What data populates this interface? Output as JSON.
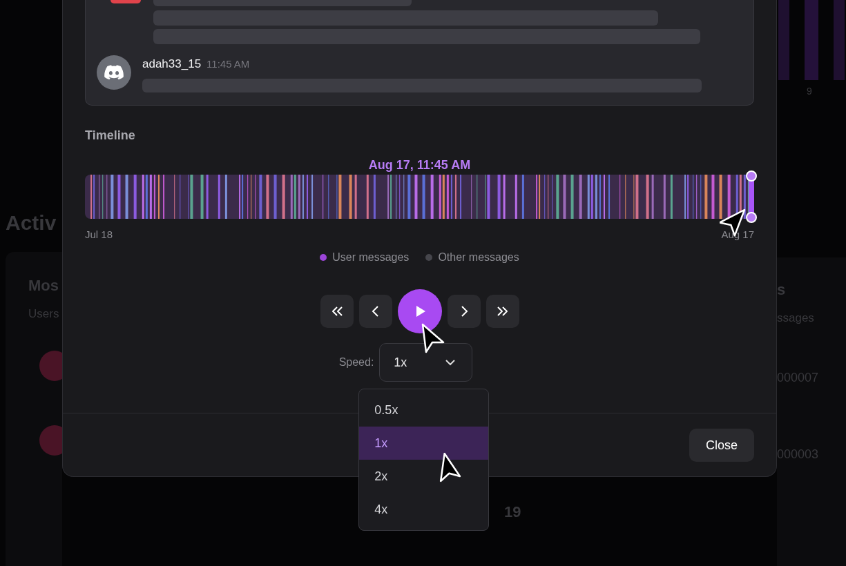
{
  "background": {
    "heading": "Activ",
    "chart_tick": "9",
    "left_card": {
      "title": "Mos",
      "subtitle": "Users"
    },
    "right_card": {
      "title": "s",
      "subtitle": "ssages",
      "values": [
        "000007",
        "000003"
      ]
    },
    "bottom_value": "19"
  },
  "modal": {
    "messages": [
      {
        "username": "adah33_15",
        "time": "11:45 AM"
      }
    ],
    "timeline": {
      "label": "Timeline",
      "current": "Aug 17, 11:45 AM",
      "start": "Jul 18",
      "end": "Aug 17",
      "level": 1,
      "legend": [
        {
          "label": "User messages",
          "color": "#9b45d8"
        },
        {
          "label": "Other messages",
          "color": "#46464c"
        }
      ]
    },
    "controls": [
      {
        "kind": "first"
      },
      {
        "kind": "prev"
      },
      {
        "kind": "play"
      },
      {
        "kind": "next"
      },
      {
        "kind": "last"
      }
    ],
    "speed": {
      "label": "Speed:",
      "value": "1x",
      "expanded": true,
      "options": [
        {
          "label": "0.5x",
          "selected": false
        },
        {
          "label": "1x",
          "selected": true
        },
        {
          "label": "2x",
          "selected": false
        },
        {
          "label": "4x",
          "selected": false
        }
      ]
    },
    "close": "Close"
  }
}
